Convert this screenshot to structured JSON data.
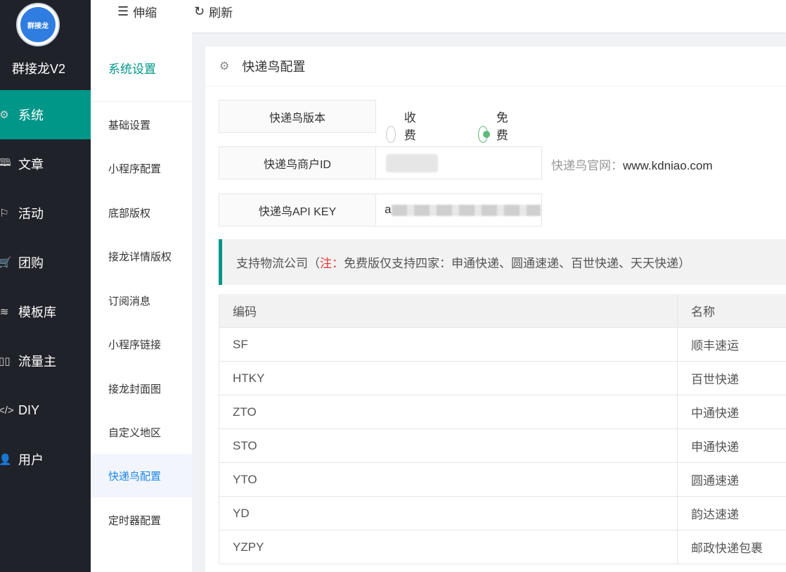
{
  "app": {
    "logo_text": "群接龙",
    "brand": "群接龙V2"
  },
  "nav": {
    "items": [
      {
        "label": "系统",
        "icon": "gear-icon",
        "active": true
      },
      {
        "label": "文章",
        "icon": "book-icon"
      },
      {
        "label": "活动",
        "icon": "flag-icon"
      },
      {
        "label": "团购",
        "icon": "cart-icon"
      },
      {
        "label": "模板库",
        "icon": "layers-icon"
      },
      {
        "label": "流量主",
        "icon": "columns-icon"
      },
      {
        "label": "DIY",
        "icon": "code-icon"
      },
      {
        "label": "用户",
        "icon": "user-icon"
      }
    ]
  },
  "header": {
    "collapse_label": "伸缩",
    "refresh_label": "刷新"
  },
  "subnav": {
    "title": "系统设置",
    "items": [
      {
        "label": "基础设置"
      },
      {
        "label": "小程序配置"
      },
      {
        "label": "底部版权"
      },
      {
        "label": "接龙详情版权"
      },
      {
        "label": "订阅消息"
      },
      {
        "label": "小程序链接"
      },
      {
        "label": "接龙封面图"
      },
      {
        "label": "自定义地区"
      },
      {
        "label": "快递鸟配置",
        "active": true
      },
      {
        "label": "定时器配置"
      }
    ]
  },
  "card": {
    "title": "快递鸟配置",
    "version_label": "快递鸟版本",
    "version_options": [
      "收费版",
      "免费版"
    ],
    "version_selected": "免费版",
    "merchant_label": "快递鸟商户ID",
    "website_label": "快递鸟官网：",
    "website": "www.kdniao.com",
    "apikey_label": "快递鸟API KEY",
    "apikey_prefix": "a",
    "note_prefix": "支持物流公司（",
    "note_red": "注：",
    "note_text": "免费版仅支持四家：申通快递、圆通速递、百世快递、天天快递）"
  },
  "table": {
    "headers": [
      "编码",
      "名称"
    ],
    "rows": [
      [
        "SF",
        "顺丰速运"
      ],
      [
        "HTKY",
        "百世快递"
      ],
      [
        "ZTO",
        "中通快递"
      ],
      [
        "STO",
        "申通快递"
      ],
      [
        "YTO",
        "圆通速递"
      ],
      [
        "YD",
        "韵达速递"
      ],
      [
        "YZPY",
        "邮政快递包裹"
      ]
    ]
  },
  "colors": {
    "accent": "#009688",
    "nav_bg": "#20222a",
    "radio_on": "#5fb878",
    "note_red": "#e53935"
  }
}
